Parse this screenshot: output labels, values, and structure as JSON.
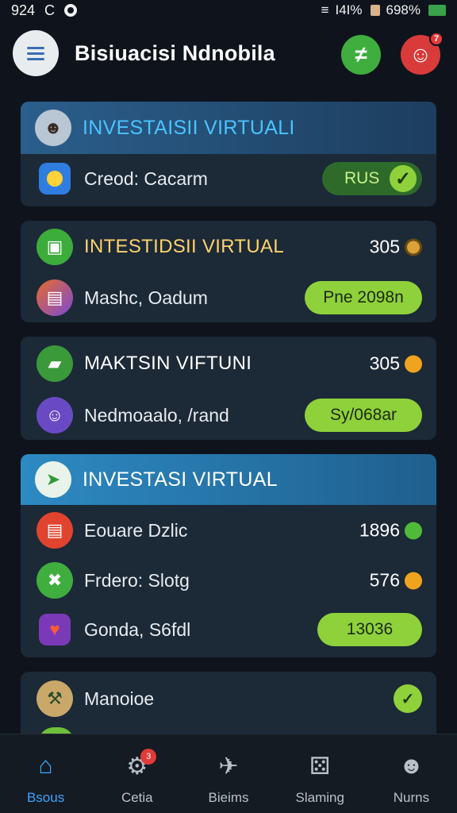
{
  "status_bar": {
    "time": "924",
    "carrier_icon": "C",
    "signal": "I4I%",
    "battery": "698%"
  },
  "header": {
    "title": "Bisiuacisi Ndnobila",
    "add_icon": "plus-icon",
    "profile_badge": "7"
  },
  "cards": [
    {
      "title": "INVESTAISII VIRTUALI",
      "rows": [
        {
          "label": "Creod: Cacarm",
          "pill": "RUS",
          "checked": true
        }
      ]
    },
    {
      "title": "INTESTIDSII VIRTUAL",
      "value": "305",
      "rows": [
        {
          "label": "Mashc, Oadum",
          "pill": "Pne 2098n"
        }
      ]
    },
    {
      "title": "MAKTSIN VIFTUNI",
      "value": "305",
      "rows": [
        {
          "label": "Nedmoaalo, /rand",
          "pill": "Sy/068ar"
        }
      ]
    },
    {
      "title": "INVESTASI VIRTUAL",
      "rows": [
        {
          "label": "Eouare Dzlic",
          "value": "1896"
        },
        {
          "label": "Frdero: Slotg",
          "value": "576"
        },
        {
          "label": "Gonda, S6fdl",
          "pill": "13036"
        }
      ]
    },
    {
      "title": "",
      "rows": [
        {
          "label": "Manoioe",
          "checked": true
        }
      ]
    }
  ],
  "bottom_nav": [
    {
      "label": "Bsous",
      "icon": "home-icon",
      "active": true
    },
    {
      "label": "Cetia",
      "icon": "gear-icon",
      "badge": "3"
    },
    {
      "label": "Bieims",
      "icon": "rocket-icon"
    },
    {
      "label": "Slaming",
      "icon": "dice-icon"
    },
    {
      "label": "Nurns",
      "icon": "user-icon"
    }
  ]
}
